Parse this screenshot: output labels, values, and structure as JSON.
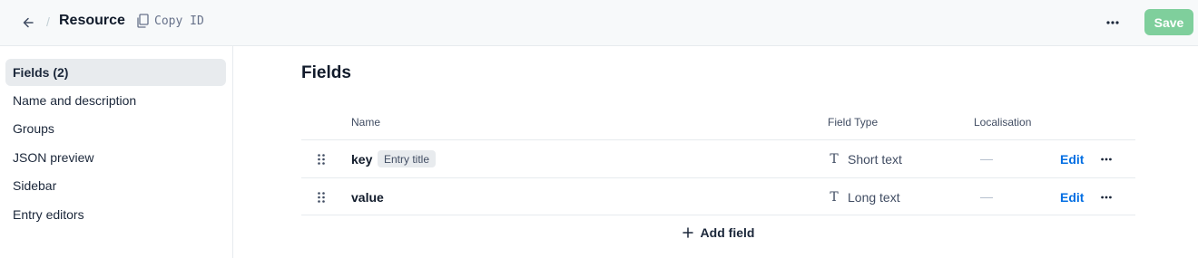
{
  "header": {
    "back_icon": "arrow-left-icon",
    "separator": "/",
    "title": "Resource",
    "copy_id_label": "Copy ID",
    "copy_icon": "copy-icon",
    "more_icon": "more-horizontal-icon",
    "save_label": "Save",
    "save_color": "#7fcf9c"
  },
  "sidebar": {
    "items": [
      {
        "label": "Fields (2)",
        "active": true
      },
      {
        "label": "Name and description"
      },
      {
        "label": "Groups"
      },
      {
        "label": "JSON preview"
      },
      {
        "label": "Sidebar"
      },
      {
        "label": "Entry editors"
      }
    ]
  },
  "main": {
    "heading": "Fields",
    "columns": {
      "name": "Name",
      "field_type": "Field Type",
      "localisation": "Localisation"
    },
    "fields": [
      {
        "name": "key",
        "badge": "Entry title",
        "type": "Short text",
        "type_icon": "text-type-icon",
        "localisation": "—",
        "action": "Edit"
      },
      {
        "name": "value",
        "type": "Long text",
        "type_icon": "text-type-icon",
        "localisation": "—",
        "action": "Edit"
      }
    ],
    "add_field_label": "Add field",
    "add_icon": "plus-icon",
    "link_color": "#036fe3"
  }
}
